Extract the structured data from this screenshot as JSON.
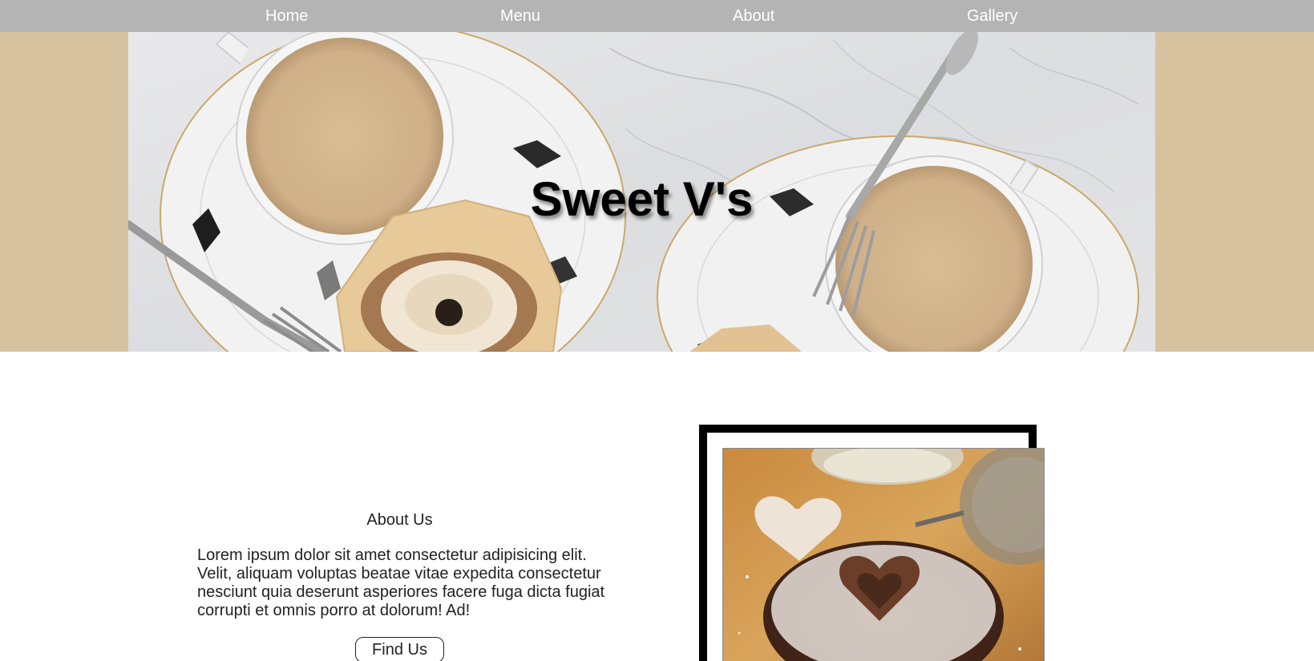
{
  "nav": {
    "items": [
      {
        "label": "Home"
      },
      {
        "label": "Menu"
      },
      {
        "label": "About"
      },
      {
        "label": "Gallery"
      }
    ]
  },
  "hero": {
    "title": "Sweet V's"
  },
  "about": {
    "heading": "About Us",
    "body": "Lorem ipsum dolor sit amet consectetur adipisicing elit. Velit, aliquam voluptas beatae vitae expedita consectetur nesciunt quia deserunt asperiores facere fuga dicta fugiat corrupti et omnis porro at dolorum! Ad!",
    "button_label": "Find Us"
  },
  "colors": {
    "nav_bg": "#b4b4b4",
    "hero_band": "#d7c2a0",
    "text": "#222222"
  }
}
